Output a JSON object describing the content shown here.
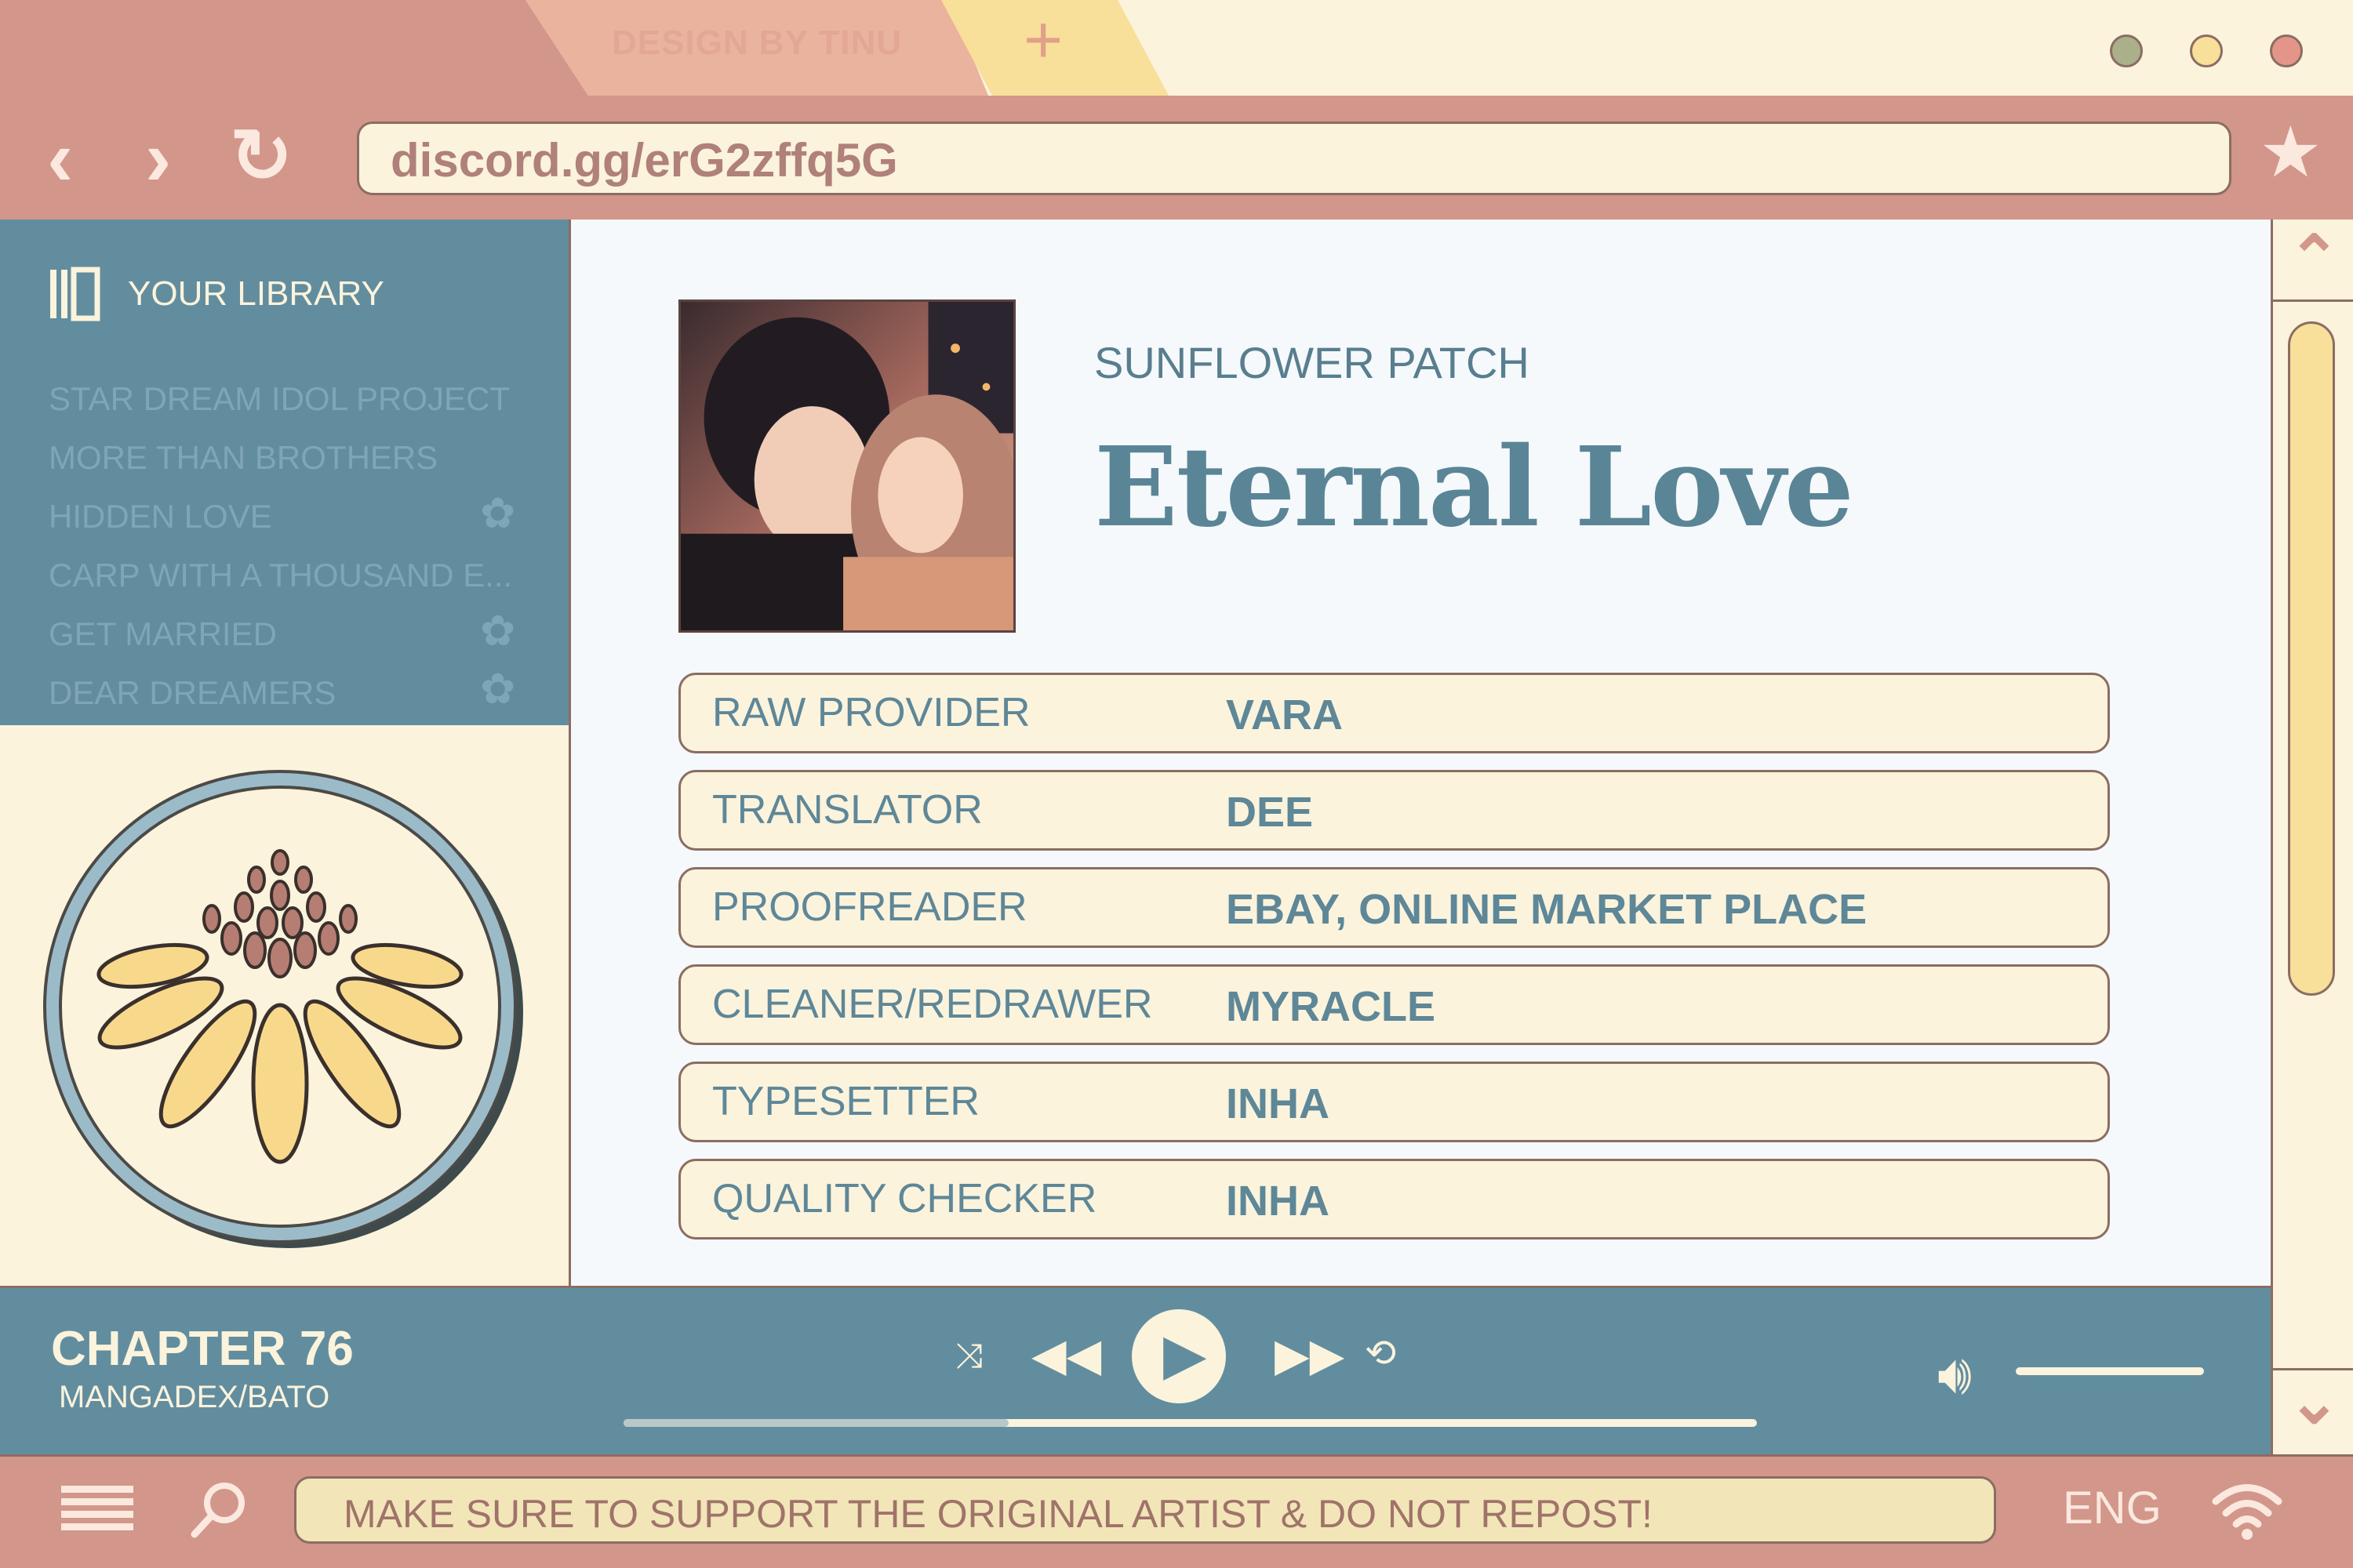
{
  "browser": {
    "tabs": [
      {
        "label": "DESIGN BY TINU"
      },
      {
        "label": "+"
      }
    ],
    "url": "discord.gg/erG2zffq5G",
    "nav": {
      "back": "‹",
      "forward": "›",
      "reload": "↻",
      "bookmark": "★"
    },
    "window_dots": [
      "#a9b08a",
      "#f8df9a",
      "#e4958a"
    ]
  },
  "sidebar": {
    "title": "YOUR LIBRARY",
    "items": [
      {
        "label": "STAR DREAM IDOL PROJECT",
        "icon": ""
      },
      {
        "label": "MORE THAN BROTHERS",
        "icon": ""
      },
      {
        "label": "HIDDEN LOVE",
        "icon": "flower-icon"
      },
      {
        "label": "CARP WITH A THOUSAND E...",
        "icon": ""
      },
      {
        "label": "GET MARRIED",
        "icon": "flower-icon"
      },
      {
        "label": "DEAR DREAMERS",
        "icon": "flower-icon"
      }
    ],
    "logo": "sunflower-logo"
  },
  "main": {
    "group": "SUNFLOWER PATCH",
    "title": "Eternal Love",
    "credits": [
      {
        "role": "RAW PROVIDER",
        "name": "VARA"
      },
      {
        "role": "TRANSLATOR",
        "name": "DEE"
      },
      {
        "role": "PROOFREADER",
        "name": "EBAY, ONLINE MARKET PLACE"
      },
      {
        "role": "CLEANER/REDRAWER",
        "name": "MYRACLE"
      },
      {
        "role": "TYPESETTER",
        "name": "INHA"
      },
      {
        "role": "QUALITY CHECKER",
        "name": "INHA"
      }
    ]
  },
  "player": {
    "chapter": "CHAPTER 76",
    "source": "MANGADEX/BATO",
    "progress": 0.34,
    "volume": 1.0
  },
  "bottom": {
    "notice": "MAKE SURE TO SUPPORT THE ORIGINAL ARTIST & DO NOT REPOST!",
    "language": "ENG"
  },
  "colors": {
    "rose": "#d3968a",
    "cream": "#fbf3dc",
    "teal": "#628d9f",
    "yellow": "#f8df9a",
    "outline": "#8b6d62"
  }
}
